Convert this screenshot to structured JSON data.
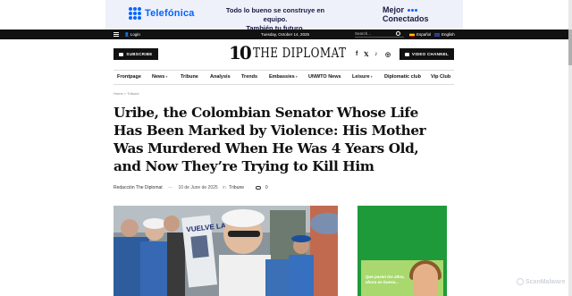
{
  "ad_banner": {
    "brand": "Telefónica",
    "tagline_line1": "Todo lo bueno se construye en equipo.",
    "tagline_line2": "También tu futuro.",
    "brand2_line1": "Mejor",
    "brand2_line2": "Conectados"
  },
  "topbar": {
    "login": "Login",
    "date": "Tuesday, October 14, 2025",
    "search_placeholder": "Search...",
    "lang_es": "Español",
    "lang_en": "English"
  },
  "header": {
    "subscribe_label": "SUBSCRIBE",
    "logo_number": "10",
    "logo_text": "THE DIPLOMAT",
    "video_label": "VIDEO CHANNEL",
    "social": [
      "f",
      "𝕏",
      "♪",
      "◎"
    ]
  },
  "nav": {
    "items": [
      {
        "label": "Frontpage",
        "has_caret": false
      },
      {
        "label": "News",
        "has_caret": true
      },
      {
        "label": "Tribune",
        "has_caret": false
      },
      {
        "label": "Analysis",
        "has_caret": false
      },
      {
        "label": "Trends",
        "has_caret": false
      },
      {
        "label": "Embassies",
        "has_caret": true
      },
      {
        "label": "UNWTO News",
        "has_caret": false
      },
      {
        "label": "Leisure",
        "has_caret": true
      },
      {
        "label": "Diplomatic club",
        "has_caret": false
      },
      {
        "label": "Vip Club",
        "has_caret": false
      }
    ]
  },
  "breadcrumb": {
    "home": "Home",
    "separator": ">",
    "section": "Tribune"
  },
  "article": {
    "headline": "Uribe, the Colombian Senator Whose Life Has Been Marked by Violence: His Mother Was Murdered When He Was 4 Years Old, and Now They’re Trying to Kill Him",
    "author": "Redacción The Diplomat",
    "dash": "—",
    "date": "10 de June de 2025",
    "in": "in",
    "category": "Tribune",
    "comment_count": "0",
    "photo_sign_text": "VUELVE LA"
  },
  "side_ad": {
    "text": "Que pasen los años, ahora en buena..."
  },
  "watermark": {
    "text": "ScanMalware"
  },
  "colors": {
    "topbar_bg": "#111111",
    "telefonica_blue": "#0066ff",
    "ad_green": "#1f9a3a"
  }
}
